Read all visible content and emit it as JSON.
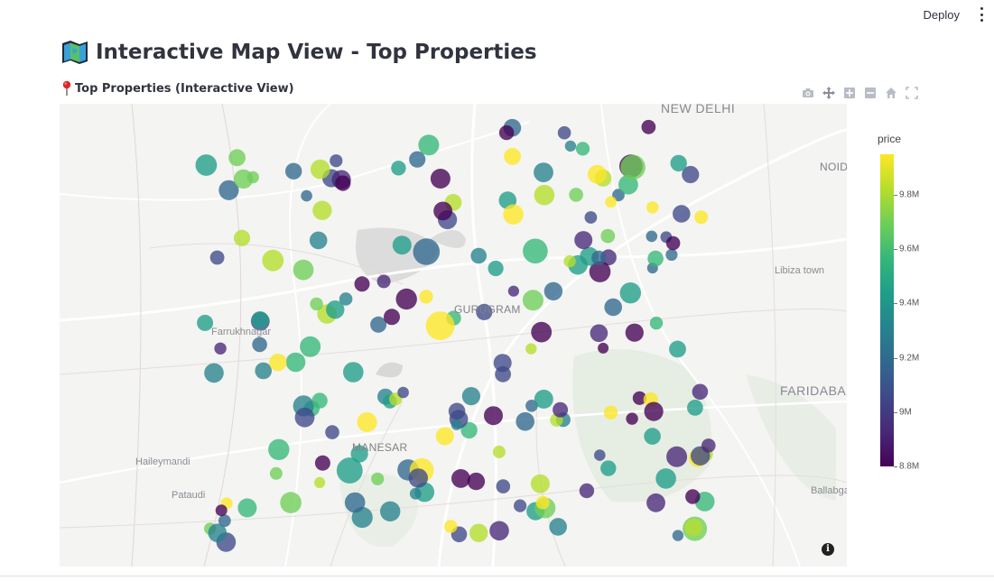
{
  "header": {
    "deploy_label": "Deploy",
    "menu_icon": "kebab-menu-icon"
  },
  "page": {
    "title": "Interactive Map View - Top Properties",
    "title_icon": "folded-map-icon",
    "subtitle": "Top Properties (Interactive View)",
    "subtitle_icon": "round-pushpin-icon"
  },
  "modebar": {
    "buttons": [
      "camera-icon",
      "pan-icon",
      "zoom-in-icon",
      "zoom-out-icon",
      "home-icon",
      "autoscale-icon"
    ]
  },
  "map": {
    "labels": {
      "new_delhi": "NEW DELHI",
      "noida": "NOID",
      "libiza_town": "Libiza town",
      "farrukhnagar": "Farrukhnagar",
      "gurugram": "GURUGRAM",
      "faridabad": "FARIDABA",
      "manesar": "MANESAR",
      "haileymandi": "Haileymandi",
      "pataudi": "Pataudi",
      "ballabgarh": "Ballabga"
    },
    "info_symbol": "i"
  },
  "colorbar": {
    "title": "price",
    "range": [
      8.8,
      9.95
    ],
    "ticks": [
      "9.8M",
      "9.6M",
      "9.4M",
      "9.2M",
      "9M",
      "8.8M"
    ],
    "tick_values": [
      9.8,
      9.6,
      9.4,
      9.2,
      9.0,
      8.8
    ],
    "colorscale": "viridis"
  }
}
